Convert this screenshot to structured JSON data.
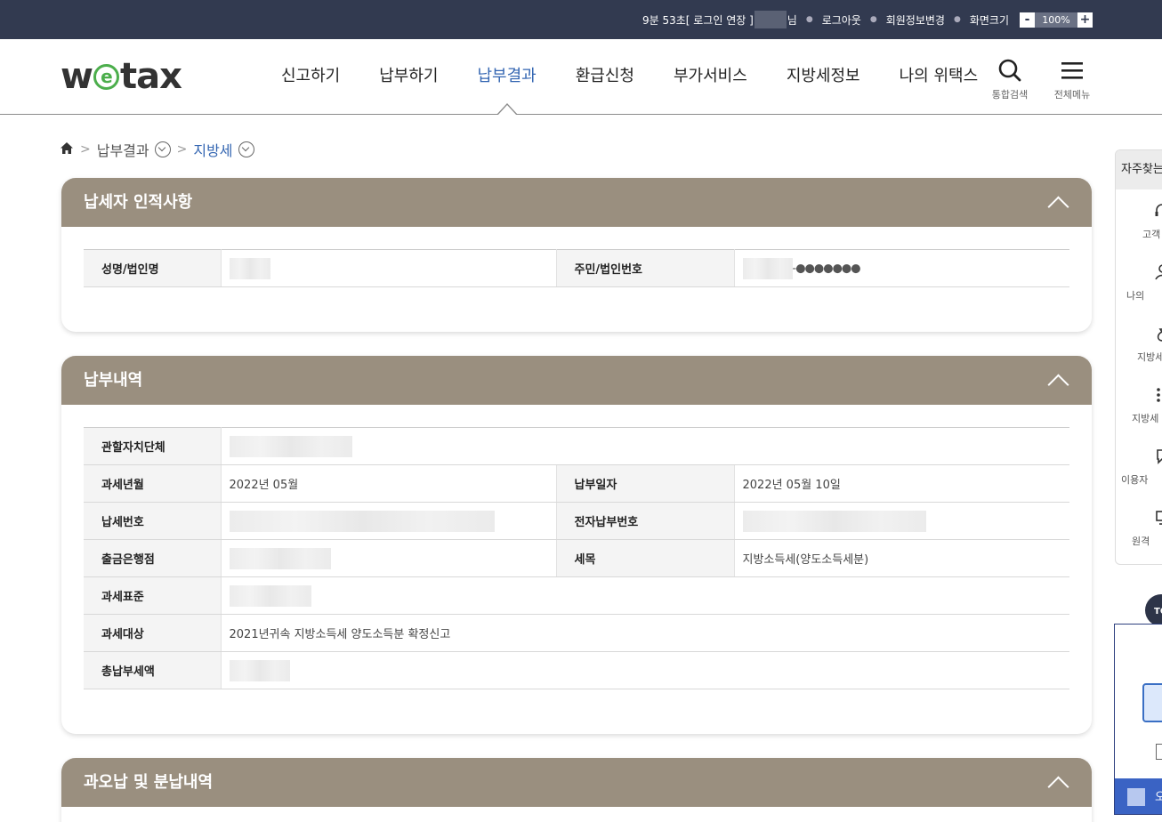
{
  "topbar": {
    "session_timer": "9분 53초[ 로그인 연장 ]",
    "user_suffix": "님",
    "logout": "로그아웃",
    "edit_profile": "회원정보변경",
    "screen_size_label": "화면크기",
    "zoom_minus": "-",
    "zoom_value": "100%",
    "zoom_plus": "+"
  },
  "logo": {
    "prefix": "w",
    "e": "e",
    "suffix": "tax"
  },
  "nav": {
    "items": [
      {
        "label": "신고하기"
      },
      {
        "label": "납부하기"
      },
      {
        "label": "납부결과"
      },
      {
        "label": "환급신청"
      },
      {
        "label": "부가서비스"
      },
      {
        "label": "지방세정보"
      },
      {
        "label": "나의 위택스"
      }
    ],
    "active_index": 2,
    "search_label": "통합검색",
    "menu_label": "전체메뉴"
  },
  "breadcrumb": {
    "level1": "납부결과",
    "level2": "지방세"
  },
  "panels": {
    "taxpayer": {
      "title": "납세자 인적사항",
      "name_label": "성명/법인명",
      "id_label": "주민/법인번호",
      "id_masked": "-●●●●●●●"
    },
    "payment": {
      "title": "납부내역",
      "rows": {
        "authority_label": "관할자치단체",
        "tax_period_label": "과세년월",
        "tax_period_value": "2022년 05월",
        "pay_date_label": "납부일자",
        "pay_date_value": "2022년 05월 10일",
        "tax_no_label": "납세번호",
        "epay_no_label": "전자납부번호",
        "bank_label": "출금은행점",
        "tax_item_label": "세목",
        "tax_item_value": "지방소득세(양도소득세분)",
        "tax_base_label": "과세표준",
        "tax_target_label": "과세대상",
        "tax_target_value": "2021년귀속 지방소득세 양도소득분 확정신고",
        "total_label": "총납부세액"
      }
    },
    "refund": {
      "title": "과오납 및 분납내역"
    }
  },
  "quick_menu": {
    "title": "자주찾는",
    "items": [
      {
        "label": "고객",
        "icon": "headset-icon"
      },
      {
        "label": "나의",
        "icon": "user-icon"
      },
      {
        "label": "지방세",
        "icon": "money-bag-icon"
      },
      {
        "label": "지방세",
        "icon": "grid-icon"
      },
      {
        "label": "이용자",
        "icon": "chat-icon"
      },
      {
        "label": "원격",
        "icon": "monitor-icon"
      }
    ],
    "top_label": "TO"
  },
  "float_banner": {
    "bar_text": "오"
  },
  "colors": {
    "topbar_bg": "#323a50",
    "panel_header": "#9a8f7f",
    "active_nav": "#3466b2",
    "logo_accent": "#4cae4c"
  }
}
